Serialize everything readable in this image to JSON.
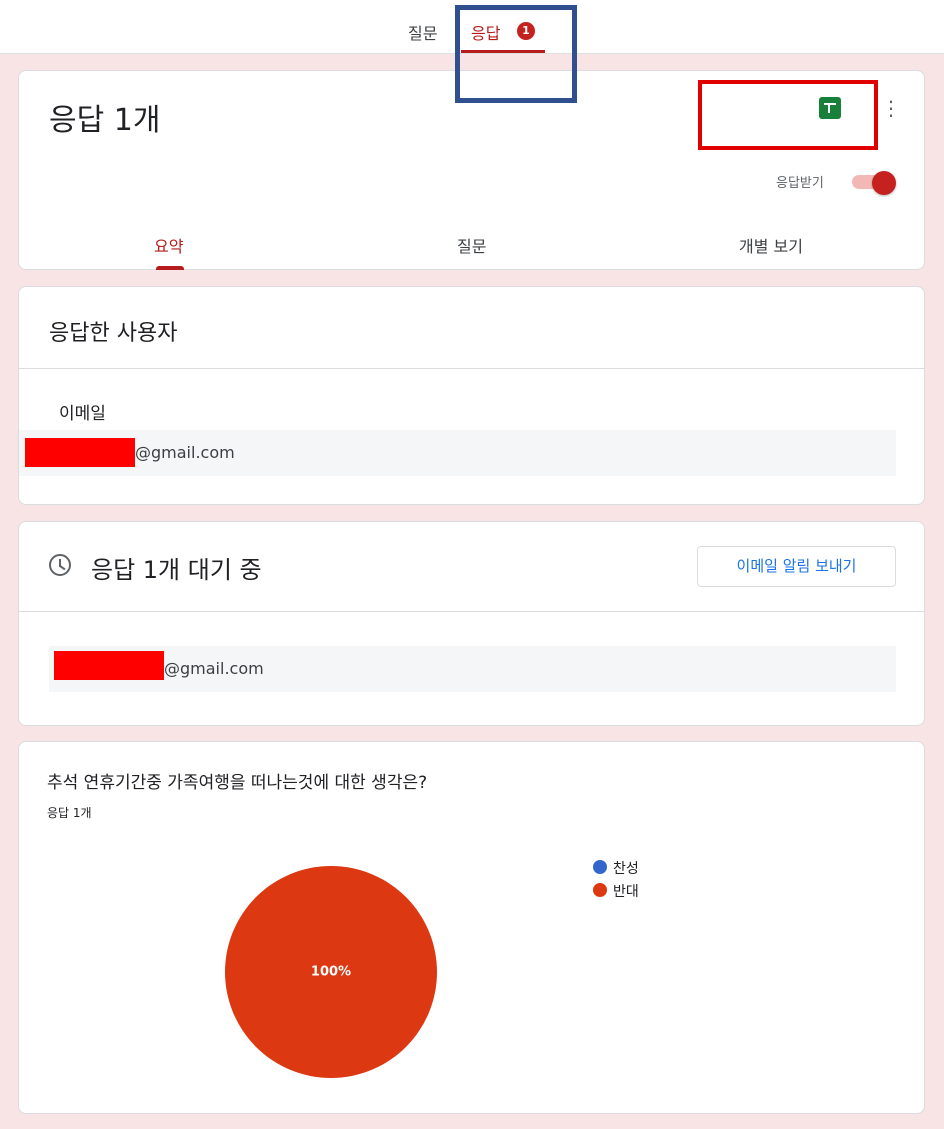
{
  "top_tabs": {
    "questions_label": "질문",
    "responses_label": "응답",
    "responses_badge": "1"
  },
  "summary_card": {
    "title": "응답 1개",
    "accepting_label": "응답받기",
    "accepting_on": true,
    "tabs": [
      {
        "label": "요약",
        "active": true
      },
      {
        "label": "질문",
        "active": false
      },
      {
        "label": "개별 보기",
        "active": false
      }
    ],
    "icons": [
      "sheets-icon",
      "more-vert-icon"
    ]
  },
  "respondents_card": {
    "heading": "응답한 사용자",
    "email_label": "이메일",
    "email_suffix": "@gmail.com"
  },
  "pending_card": {
    "heading": "응답 1개 대기 중",
    "send_button": "이메일 알림 보내기",
    "email_suffix": "@gmail.com",
    "icon": "clock-icon"
  },
  "question_card": {
    "title": "추석 연휴기간중 가족여행을 떠나는것에 대한 생각은?",
    "count": "응답 1개",
    "legend": [
      {
        "label": "찬성",
        "color": "#3366cc"
      },
      {
        "label": "반대",
        "color": "#dc3912"
      }
    ],
    "pie_label": "100%"
  },
  "chart_data": {
    "type": "pie",
    "categories": [
      "찬성",
      "반대"
    ],
    "values": [
      0,
      100
    ],
    "colors": [
      "#3366cc",
      "#dc3912"
    ],
    "legend_position": "right"
  },
  "colors": {
    "accent": "#b71c1c",
    "background": "#f8e4e4",
    "link": "#1a73e8"
  }
}
